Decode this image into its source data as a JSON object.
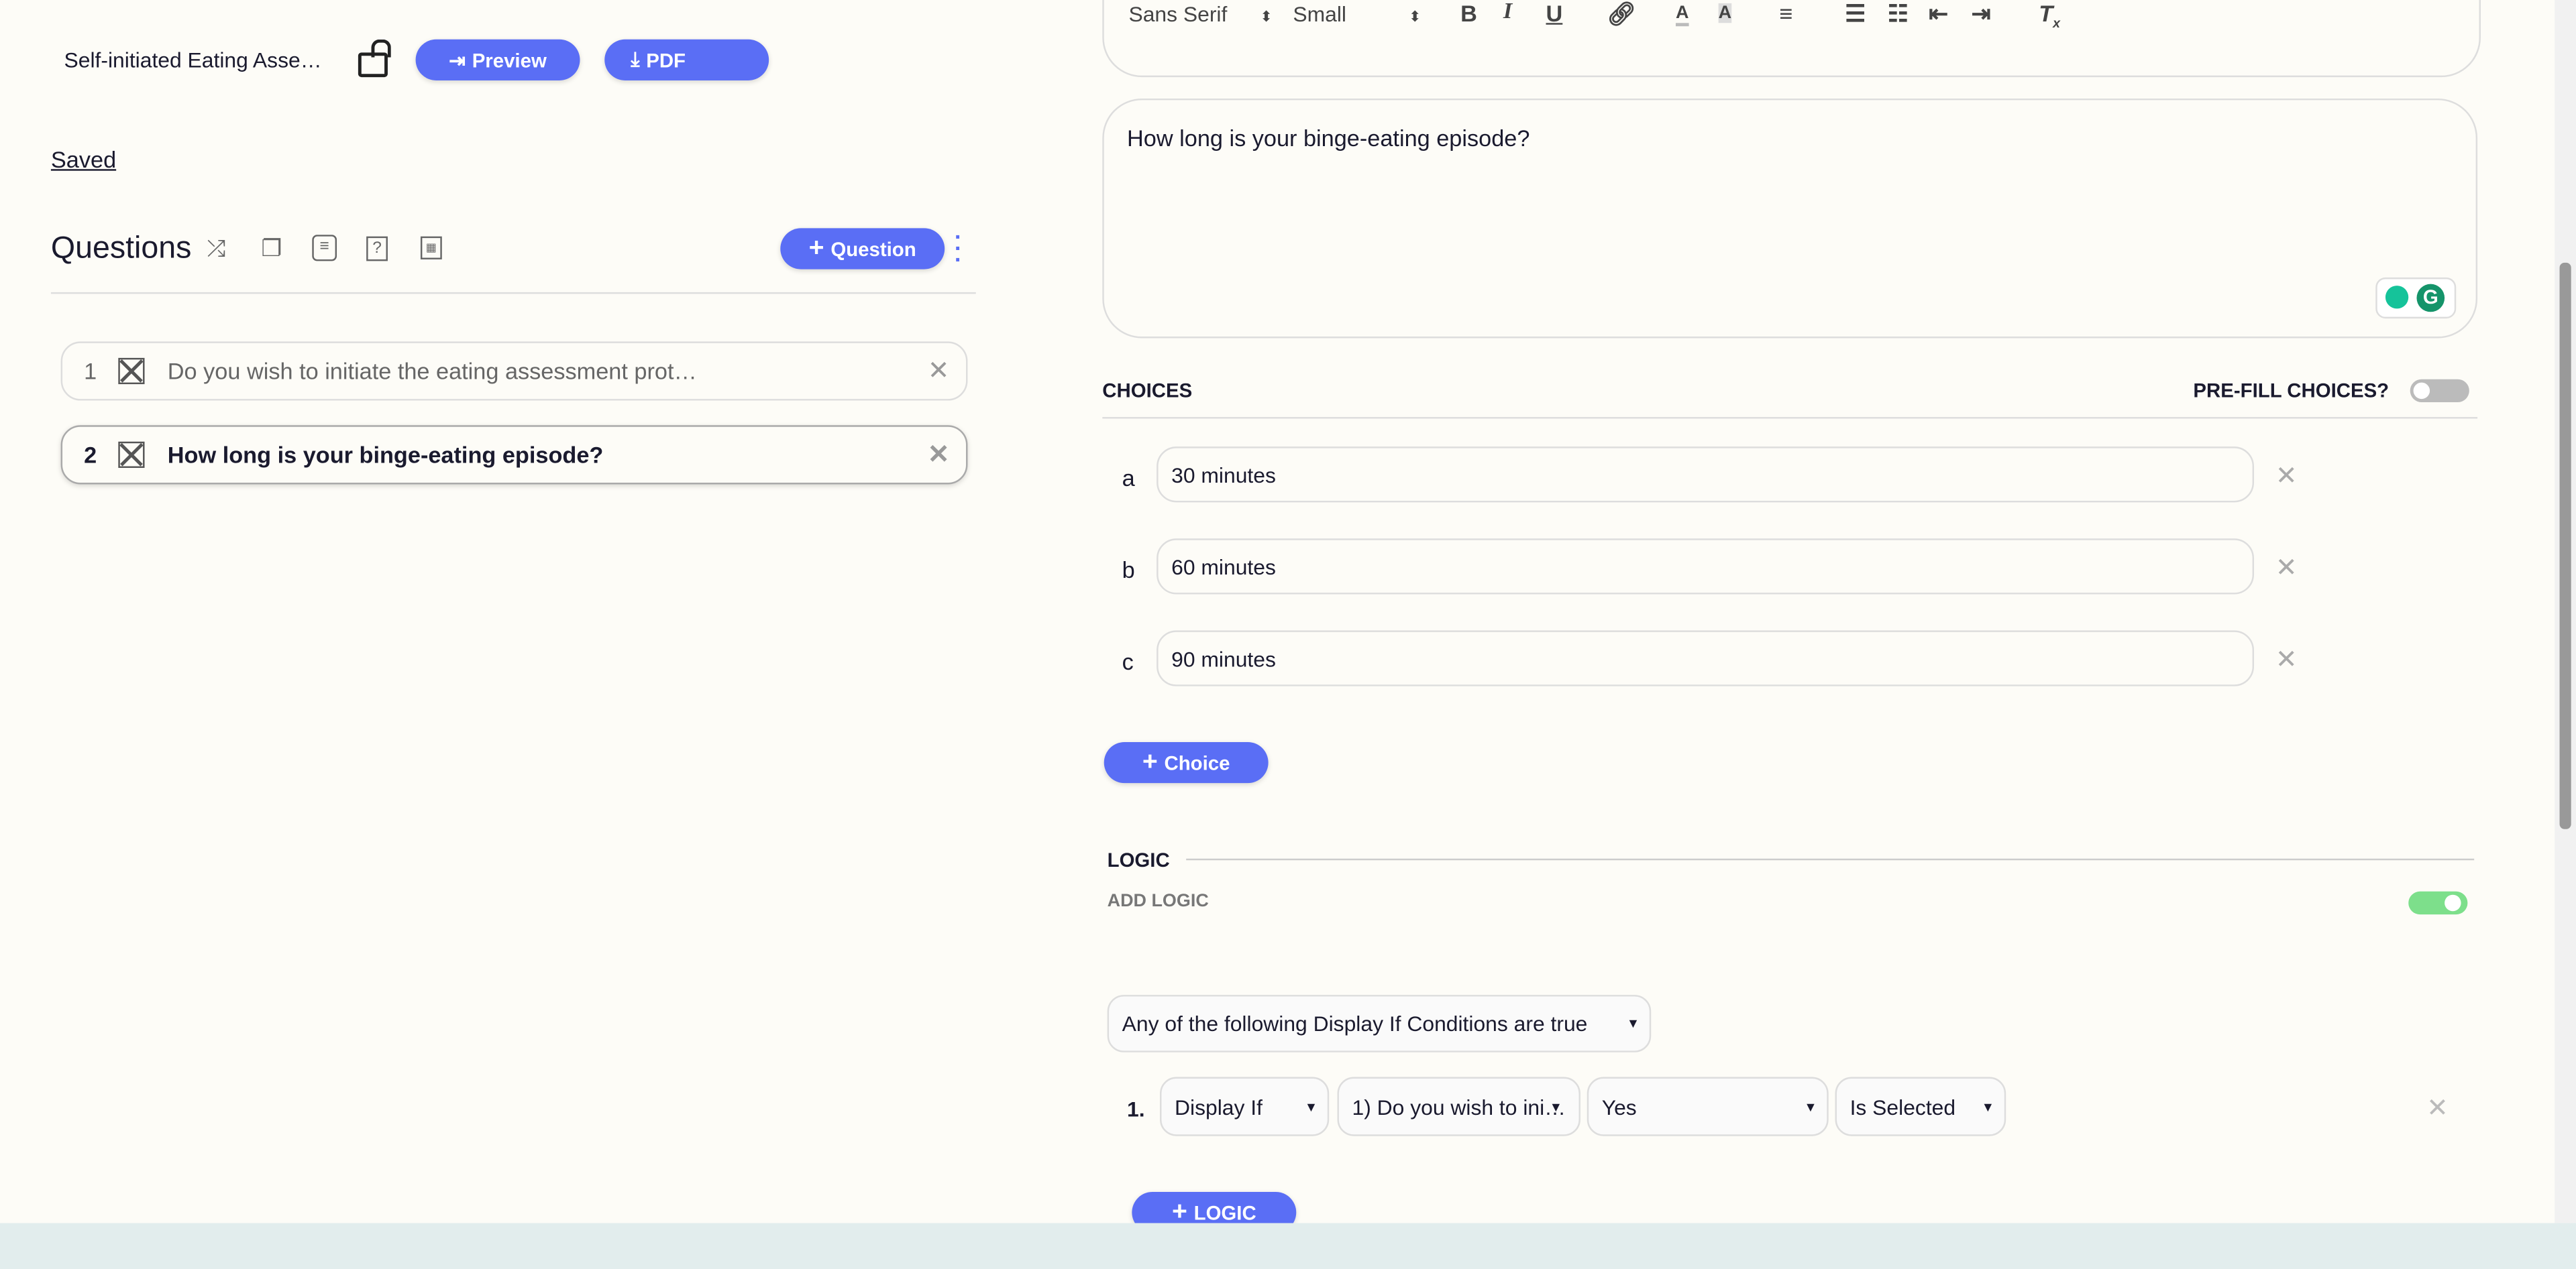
{
  "header": {
    "title": "Self-initiated Eating Asse…",
    "preview_label": "Preview",
    "pdf_label": "PDF",
    "status": "Saved"
  },
  "questions": {
    "title": "Questions",
    "add_label": "Question",
    "items": [
      {
        "number": "1",
        "text": "Do you wish to initiate the eating assessment prot…",
        "selected": false
      },
      {
        "number": "2",
        "text": "How long is your binge-eating episode?",
        "selected": true
      }
    ]
  },
  "editor": {
    "font": "Sans Serif",
    "size": "Small",
    "content": "How long is your binge-eating episode?"
  },
  "choices": {
    "title": "CHOICES",
    "prefill_label": "PRE-FILL CHOICES?",
    "prefill_on": false,
    "items": [
      {
        "letter": "a",
        "value": "30 minutes"
      },
      {
        "letter": "b",
        "value": "60 minutes"
      },
      {
        "letter": "c",
        "value": "90 minutes"
      }
    ],
    "add_label": "Choice"
  },
  "logic": {
    "title": "LOGIC",
    "add_logic_label": "ADD LOGIC",
    "enabled": true,
    "mode": "Any of the following Display If Conditions are true",
    "conditions": [
      {
        "number": "1.",
        "type": "Display If",
        "question": "1) Do you wish to ini…",
        "answer": "Yes",
        "operator": "Is Selected"
      }
    ],
    "add_label": "LOGIC"
  },
  "colors": {
    "accent": "#5a6ef5",
    "toggle_on": "#7ddf8b",
    "footer": "#e2eded"
  }
}
